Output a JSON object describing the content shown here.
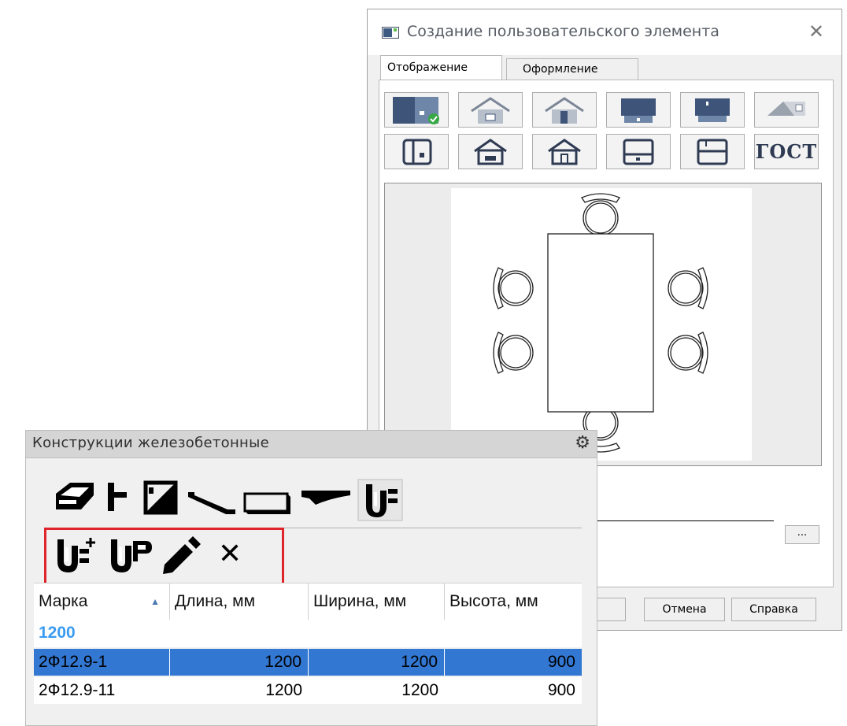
{
  "dialog": {
    "title": "Создание пользовательского элемента",
    "close_glyph": "✕",
    "tabs": [
      {
        "label": "Отображение",
        "active": true
      },
      {
        "label": "Оформление",
        "active": false
      }
    ],
    "view_buttons_row1": [
      "plan-view-checked-icon",
      "house-icon",
      "house-door-icon",
      "block-icon",
      "block-top-icon",
      "roof-icon"
    ],
    "view_buttons_row2": [
      "plan-square-icon",
      "house-outline-icon",
      "house-outline-2-icon",
      "box-outline-icon",
      "box-top-outline-icon",
      "gost-icon"
    ],
    "gost_label": "ГОСТ",
    "preview": "table-with-chairs-drawing",
    "browse_label": "...",
    "buttons": {
      "cancel": "Отмена",
      "help": "Справка"
    }
  },
  "palette": {
    "title": "Конструкции железобетонные",
    "category_icons": [
      "slab-icon",
      "column-icon",
      "panel-icon",
      "stair-icon",
      "plate-icon",
      "beam-icon",
      "foundation-icon"
    ],
    "tool_icons": [
      "add-element-icon",
      "element-properties-icon",
      "edit-pencil-icon",
      "delete-icon"
    ],
    "delete_glyph": "✕",
    "table": {
      "columns": [
        "Марка",
        "Длина, мм",
        "Ширина, мм",
        "Высота, мм"
      ],
      "group": "1200",
      "rows": [
        {
          "mark": "2Ф12.9-1",
          "length": "1200",
          "width": "1200",
          "height": "900",
          "selected": true
        },
        {
          "mark": "2Ф12.9-11",
          "length": "1200",
          "width": "1200",
          "height": "900",
          "selected": false
        }
      ]
    }
  },
  "colors": {
    "selection": "#3277d2",
    "group_text": "#3a9bf0",
    "highlight": "#e0242c",
    "icon_dark": "#2f3b53"
  }
}
